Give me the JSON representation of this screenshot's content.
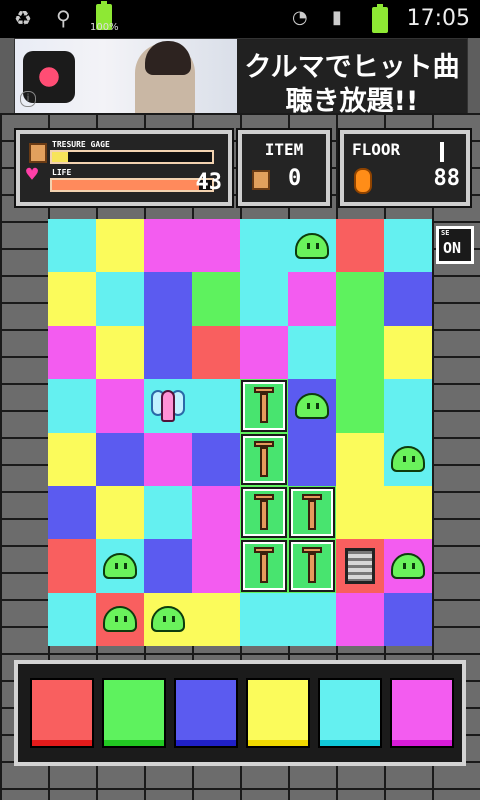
{
  "status_bar": {
    "battery": "100%",
    "time": "17:05"
  },
  "ad": {
    "line1": "クルマでヒット曲",
    "line2": "聴き放題!!",
    "info": "i"
  },
  "hud": {
    "treasure_label": "TRESURE GAGE",
    "treasure_gauge": 0.1,
    "life_label": "LIFE",
    "life_gauge": 0.92,
    "life_value": "43",
    "item_title": "ITEM",
    "item_count": "0",
    "floor_title": "FLOOR",
    "floor_number": "88"
  },
  "se_toggle": {
    "label": "SE",
    "value": "ON"
  },
  "colors": {
    "red": "#f95f5f",
    "green": "#5ef25e",
    "blue": "#5b5bf0",
    "yellow": "#fbfb5b",
    "cyan": "#64f0f0",
    "magenta": "#f35cf0",
    "strip_red": "#e41b1b",
    "strip_green": "#22c922",
    "strip_blue": "#2020c8",
    "strip_yellow": "#f0d800",
    "strip_cyan": "#10c8d8",
    "strip_magenta": "#d81bd8"
  },
  "board": {
    "rows": [
      [
        "cyan",
        "yellow",
        "magenta",
        "magenta",
        "cyan",
        "cyan",
        "red",
        "cyan"
      ],
      [
        "yellow",
        "cyan",
        "blue",
        "green",
        "cyan",
        "magenta",
        "green",
        "blue"
      ],
      [
        "magenta",
        "yellow",
        "blue",
        "red",
        "magenta",
        "cyan",
        "green",
        "yellow"
      ],
      [
        "cyan",
        "magenta",
        "cyan",
        "cyan",
        "green",
        "blue",
        "green",
        "cyan"
      ],
      [
        "yellow",
        "blue",
        "magenta",
        "blue",
        "green",
        "blue",
        "yellow",
        "cyan"
      ],
      [
        "blue",
        "yellow",
        "cyan",
        "magenta",
        "green",
        "green",
        "yellow",
        "yellow"
      ],
      [
        "red",
        "cyan",
        "blue",
        "magenta",
        "green",
        "green",
        "red",
        "magenta"
      ],
      [
        "cyan",
        "red",
        "yellow",
        "yellow",
        "cyan",
        "cyan",
        "magenta",
        "blue"
      ]
    ],
    "entities": [
      {
        "type": "slime",
        "row": 0,
        "col": 5
      },
      {
        "type": "fairy",
        "row": 3,
        "col": 2
      },
      {
        "type": "pillar",
        "row": 3,
        "col": 4
      },
      {
        "type": "slime",
        "row": 3,
        "col": 5
      },
      {
        "type": "pillar",
        "row": 4,
        "col": 4
      },
      {
        "type": "slime",
        "row": 4,
        "col": 7
      },
      {
        "type": "pillar",
        "row": 5,
        "col": 4
      },
      {
        "type": "pillar",
        "row": 5,
        "col": 5
      },
      {
        "type": "slime",
        "row": 6,
        "col": 1
      },
      {
        "type": "pillar",
        "row": 6,
        "col": 4
      },
      {
        "type": "pillar",
        "row": 6,
        "col": 5
      },
      {
        "type": "stairs",
        "row": 6,
        "col": 6
      },
      {
        "type": "slime",
        "row": 6,
        "col": 7
      },
      {
        "type": "slime",
        "row": 7,
        "col": 1
      },
      {
        "type": "slime",
        "row": 7,
        "col": 2
      }
    ]
  },
  "palette": [
    "red",
    "green",
    "blue",
    "yellow",
    "cyan",
    "magenta"
  ]
}
